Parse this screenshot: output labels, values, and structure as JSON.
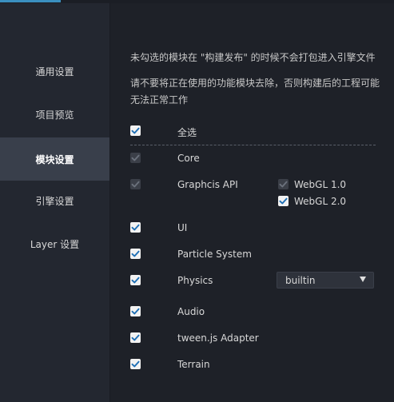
{
  "sidebar": {
    "items": [
      {
        "label": "通用设置"
      },
      {
        "label": "项目预览"
      },
      {
        "label": "模块设置",
        "active": true
      },
      {
        "label": "引擎设置"
      },
      {
        "label": "Layer 设置"
      }
    ]
  },
  "notes": {
    "line1": "未勾选的模块在 \"构建发布\" 的时候不会打包进入引擎文件",
    "line2": "请不要将正在使用的功能模块去除，否则构建后的工程可能无法正常工作"
  },
  "select_all": {
    "label": "全选",
    "checked": true
  },
  "modules": [
    {
      "label": "Core",
      "checked": true,
      "disabled": true
    },
    {
      "label": "Graphcis API",
      "checked": true,
      "disabled": true,
      "options": [
        {
          "label": "WebGL 1.0",
          "checked": true,
          "disabled": true
        },
        {
          "label": "WebGL 2.0",
          "checked": true,
          "disabled": false
        }
      ]
    },
    {
      "label": "UI",
      "checked": true
    },
    {
      "label": "Particle System",
      "checked": true
    },
    {
      "label": "Physics",
      "checked": true,
      "select_value": "builtin"
    },
    {
      "label": "Audio",
      "checked": true
    },
    {
      "label": "tween.js Adapter",
      "checked": true
    },
    {
      "label": "Terrain",
      "checked": true
    }
  ],
  "colors": {
    "check": "#1e6fb5",
    "check_disabled": "#6b717c",
    "accent": "#3a8fbf"
  }
}
